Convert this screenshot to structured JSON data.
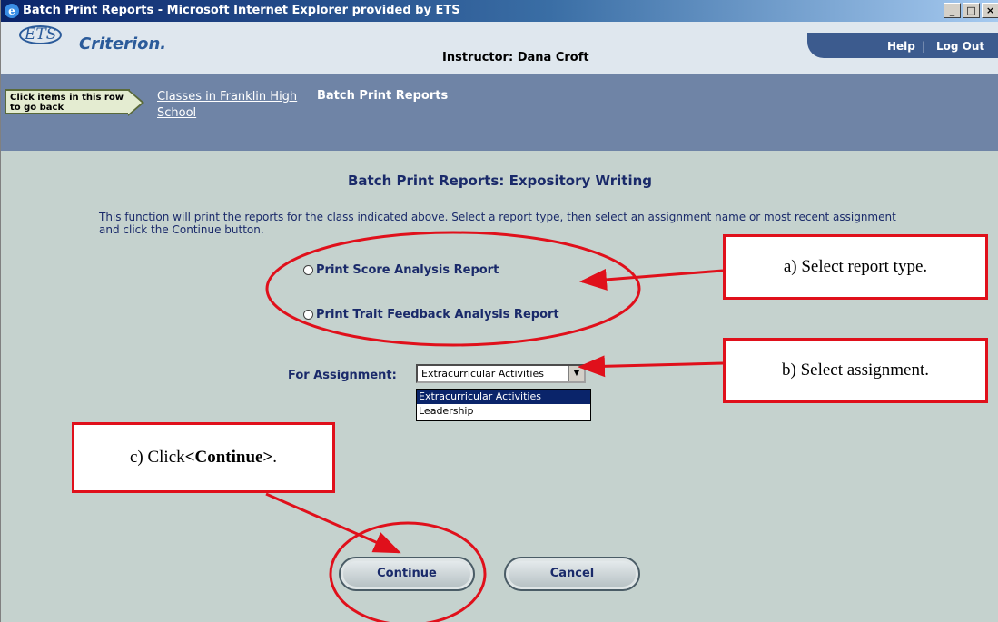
{
  "window": {
    "title": "Batch Print Reports - Microsoft Internet Explorer provided by ETS",
    "minimize_glyph": "_",
    "maximize_glyph": "□",
    "close_glyph": "×"
  },
  "header": {
    "logo_ets": "ETS",
    "logo_name": "Criterion.",
    "instructor": "Instructor: Dana Croft",
    "help": "Help",
    "separator": "|",
    "logout": "Log Out"
  },
  "breadcrumb": {
    "goback_hint": "Click items in this row to go back",
    "link": "Classes in Franklin High School",
    "current": "Batch Print Reports"
  },
  "main": {
    "title": "Batch Print Reports: Expository Writing",
    "description": "This function will print the reports for the class indicated above. Select a report type, then select an assignment name or most recent assignment and click the Continue button.",
    "report_types": [
      {
        "label": "Print Score Analysis Report",
        "selected": false
      },
      {
        "label": "Print Trait Feedback Analysis Report",
        "selected": false
      }
    ],
    "assignment_label": "For Assignment:",
    "assignment_value": "Extracurricular Activities",
    "assignment_options": [
      "Extracurricular Activities",
      "Leadership"
    ],
    "continue_label": "Continue",
    "cancel_label": "Cancel"
  },
  "annotations": {
    "step_a": "a) Select report type.",
    "step_b": "b) Select assignment.",
    "step_c_prefix": "c) Click ",
    "step_c_bold": "<Continue>",
    "step_c_suffix": ".",
    "color": "#e0101b"
  }
}
